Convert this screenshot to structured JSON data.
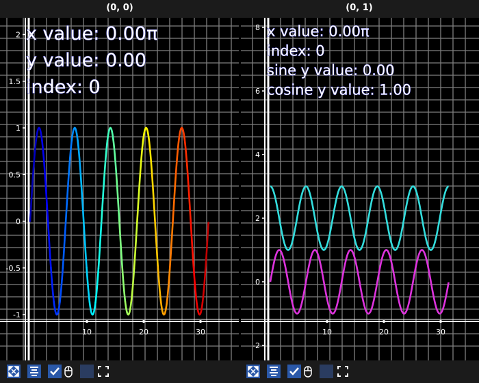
{
  "window": {
    "subplot_titles": [
      "(0, 0)",
      "(0, 1)"
    ]
  },
  "colors": {
    "background": "#000000",
    "grid": "#7f7f7f",
    "axis": "#ffffff",
    "readout_text": "#ffffff",
    "readout_outline": "#4444cc",
    "cyan_series": "#33dddd",
    "magenta_series": "#dd33dd"
  },
  "toolbar": {
    "icons": [
      "fit-view-icon",
      "align-icon",
      "checkbox-icon",
      "mouse-icon",
      "blank-box-icon",
      "fullscreen-icon"
    ]
  },
  "chart_data": [
    {
      "type": "line",
      "title": "(0, 0)",
      "xlim": [
        -1,
        32.5
      ],
      "ylim": [
        -1.15,
        2.15
      ],
      "x_ticks": [
        10,
        20,
        30
      ],
      "y_ticks": [
        -1,
        -0.5,
        0,
        0.5,
        1,
        1.5,
        2
      ],
      "y_tick_labels": [
        "-1",
        "-0.5",
        "0",
        "0.5",
        "1",
        "1.5",
        "2"
      ],
      "grid": true,
      "series": [
        {
          "x_start": 0,
          "x_end": 31.4,
          "function": "sine",
          "amplitude": 1,
          "offset": 0,
          "period": 6.2832,
          "colormap": "jet"
        }
      ],
      "readout": [
        "x value: 0.00π",
        "y value: 0.00",
        "index: 0"
      ],
      "crosshair_x": 0
    },
    {
      "type": "line",
      "title": "(0, 1)",
      "xlim": [
        -1,
        32.5
      ],
      "ylim": [
        -2.2,
        8.4
      ],
      "x_ticks": [
        10,
        20,
        30
      ],
      "y_ticks": [
        -2,
        0,
        2,
        4,
        6,
        8
      ],
      "y_tick_labels": [
        "-2",
        "0",
        "2",
        "4",
        "6",
        "8"
      ],
      "grid": true,
      "series": [
        {
          "x_start": 0,
          "x_end": 31.4,
          "function": "cosine",
          "amplitude": 1,
          "offset": 2,
          "period": 6.2832,
          "color": "#33dddd"
        },
        {
          "x_start": 0,
          "x_end": 31.4,
          "function": "sine",
          "amplitude": 1,
          "offset": 0,
          "period": 6.2832,
          "color": "#dd33dd"
        }
      ],
      "readout": [
        "x value: 0.00π",
        "index: 0",
        "sine y value: 0.00",
        "cosine y value: 1.00"
      ],
      "crosshair_x": 0
    }
  ]
}
